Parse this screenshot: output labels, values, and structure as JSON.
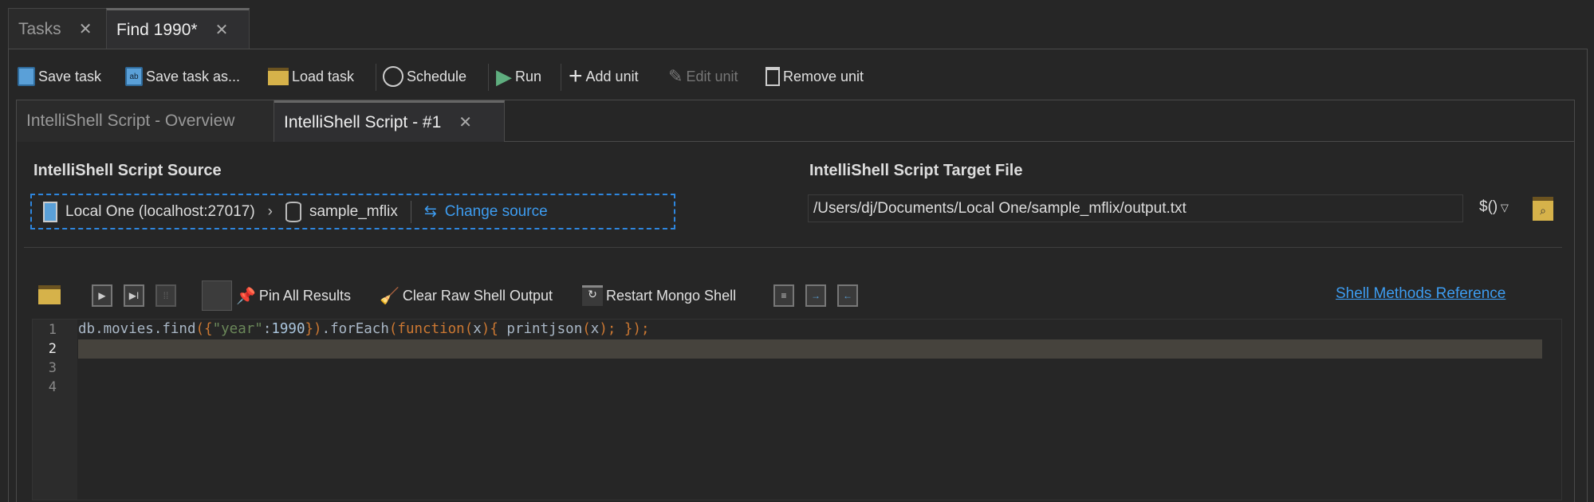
{
  "tabs": [
    {
      "label": "Tasks",
      "active": false
    },
    {
      "label": "Find 1990*",
      "active": true
    }
  ],
  "toolbar": {
    "save_task": "Save task",
    "save_task_as": "Save task as...",
    "load_task": "Load task",
    "schedule": "Schedule",
    "run": "Run",
    "add_unit": "Add unit",
    "edit_unit": "Edit unit",
    "remove_unit": "Remove unit"
  },
  "inner_tabs": [
    {
      "label": "IntelliShell Script - Overview",
      "active": false
    },
    {
      "label": "IntelliShell Script - #1",
      "active": true
    }
  ],
  "source": {
    "heading": "IntelliShell Script Source",
    "connection": "Local One (localhost:27017)",
    "database": "sample_mflix",
    "change_label": "Change source"
  },
  "target": {
    "heading": "IntelliShell Script Target File",
    "path": "/Users/dj/Documents/Local One/sample_mflix/output.txt",
    "variable_label": "$()"
  },
  "shell_toolbar": {
    "pin_all": "Pin All Results",
    "clear_output": "Clear Raw Shell Output",
    "restart": "Restart Mongo Shell",
    "reference_link": "Shell Methods Reference"
  },
  "editor": {
    "line_numbers": [
      "1",
      "2",
      "3",
      "4"
    ],
    "current_line": 2,
    "code": {
      "p1": "db.movies.find",
      "p2": "({",
      "p3": "\"year\"",
      "p4": ":",
      "p5": "1990",
      "p6": "})",
      "p7": ".forEach",
      "p8": "(function(",
      "p9": "x",
      "p10": "){",
      " p11": "",
      "p12": " printjson",
      "p13": "(",
      "p14": "x",
      "p15": "); });"
    }
  }
}
